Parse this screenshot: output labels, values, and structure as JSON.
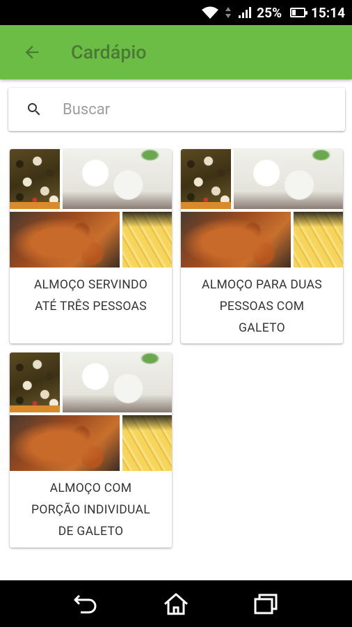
{
  "status_bar": {
    "battery": "25%",
    "time": "15:14"
  },
  "app_bar": {
    "title": "Cardápio"
  },
  "search": {
    "placeholder": "Buscar"
  },
  "menu_items": [
    {
      "label_lines": [
        "ALMOÇO SERVINDO",
        "ATÉ TRÊS PESSOAS"
      ]
    },
    {
      "label_lines": [
        "ALMOÇO PARA DUAS",
        "PESSOAS COM",
        "GALETO"
      ]
    },
    {
      "label_lines": [
        "ALMOÇO COM",
        "PORÇÃO INDIVIDUAL",
        "DE GALETO"
      ]
    }
  ],
  "colors": {
    "app_bar": "#6cbd45",
    "title": "#4a7a35"
  }
}
